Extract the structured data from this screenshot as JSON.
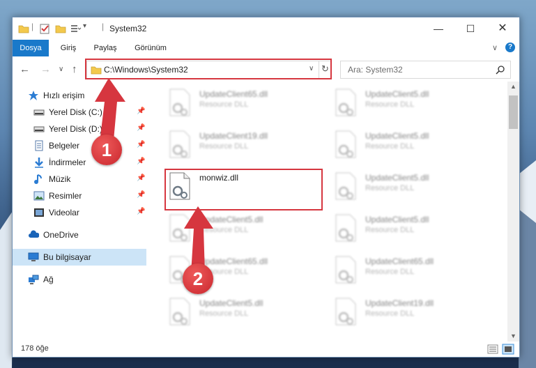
{
  "window": {
    "title": "System32"
  },
  "ribbon": {
    "tabs": [
      "Dosya",
      "Giriş",
      "Paylaş",
      "Görünüm"
    ]
  },
  "address": {
    "path": "C:\\Windows\\System32"
  },
  "search": {
    "placeholder": "Ara: System32"
  },
  "sidebar": {
    "items": [
      {
        "label": "Hızlı erişim",
        "icon": "star-icon"
      },
      {
        "label": "Yerel Disk (C:)",
        "icon": "drive-icon"
      },
      {
        "label": "Yerel Disk (D:)",
        "icon": "drive-icon"
      },
      {
        "label": "Belgeler",
        "icon": "document-icon"
      },
      {
        "label": "İndirmeler",
        "icon": "download-icon"
      },
      {
        "label": "Müzik",
        "icon": "music-icon"
      },
      {
        "label": "Resimler",
        "icon": "pictures-icon"
      },
      {
        "label": "Videolar",
        "icon": "video-icon"
      },
      {
        "label": "OneDrive",
        "icon": "cloud-icon"
      },
      {
        "label": "Bu bilgisayar",
        "icon": "computer-icon"
      },
      {
        "label": "Ağ",
        "icon": "network-icon"
      }
    ]
  },
  "files": {
    "left": [
      {
        "name": "UpdateClient65.dll",
        "type": "Resource DLL"
      },
      {
        "name": "UpdateClient19.dll",
        "type": "Resource DLL"
      },
      {
        "name": "monwiz.dll",
        "type": ""
      },
      {
        "name": "UpdateClient5.dll",
        "type": "Resource DLL"
      },
      {
        "name": "UpdateClient65.dll",
        "type": "Resource DLL"
      },
      {
        "name": "UpdateClient5.dll",
        "type": "Resource DLL"
      }
    ],
    "right": [
      {
        "name": "UpdateClient5.dll",
        "type": "Resource DLL"
      },
      {
        "name": "UpdateClient5.dll",
        "type": "Resource DLL"
      },
      {
        "name": "UpdateClient5.dll",
        "type": "Resource DLL"
      },
      {
        "name": "UpdateClient5.dll",
        "type": "Resource DLL"
      },
      {
        "name": "UpdateClient65.dll",
        "type": "Resource DLL"
      },
      {
        "name": "UpdateClient19.dll",
        "type": "Resource DLL"
      }
    ]
  },
  "status": {
    "count": "178 öğe"
  },
  "annotations": {
    "step1": "1",
    "step2": "2",
    "color": "#d6363f"
  }
}
